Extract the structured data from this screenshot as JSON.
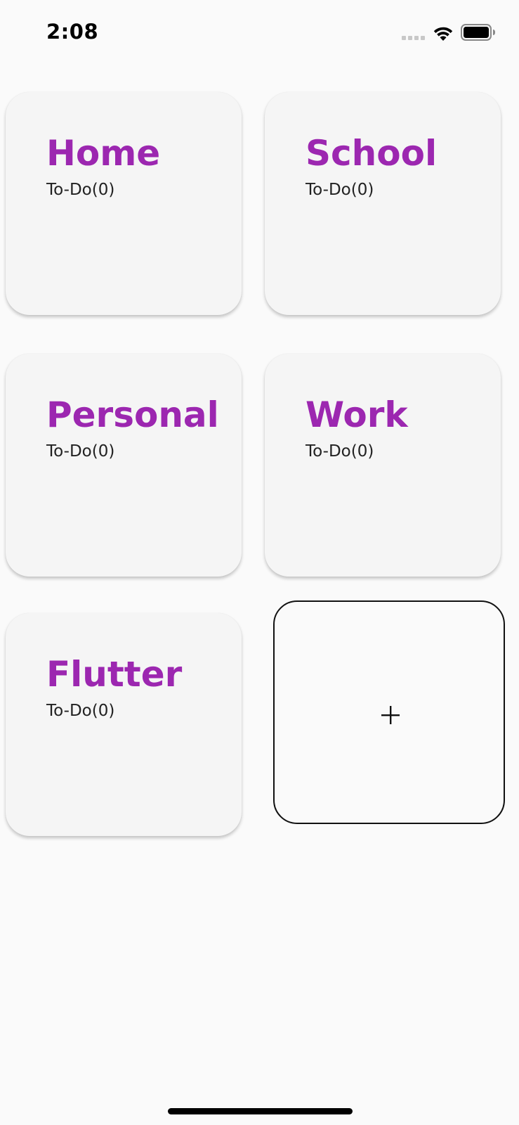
{
  "status_bar": {
    "time": "2:08",
    "icons": [
      "signal-icon",
      "wifi-icon",
      "battery-icon"
    ]
  },
  "categories": [
    {
      "title": "Home",
      "count_label": "To-Do(0)"
    },
    {
      "title": "School",
      "count_label": "To-Do(0)"
    },
    {
      "title": "Personal",
      "count_label": "To-Do(0)"
    },
    {
      "title": "Work",
      "count_label": "To-Do(0)"
    },
    {
      "title": "Flutter",
      "count_label": "To-Do(0)"
    }
  ],
  "add_card": {
    "icon": "plus-icon"
  },
  "colors": {
    "title": "#9c27b0",
    "card_background": "#f5f5f5",
    "page_background": "#fafafa"
  }
}
